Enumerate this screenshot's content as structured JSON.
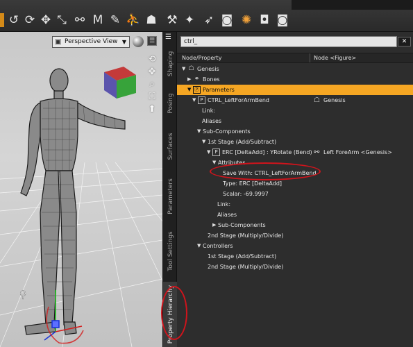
{
  "toolbar": {
    "icons": [
      "pointer-swirl-icon",
      "rotate-icon",
      "move-icon",
      "scale-icon",
      "joint-icon",
      "node-icon",
      "paint-icon",
      "figure-icon",
      "figure-select-icon",
      "morph-icon",
      "bone-icon",
      "pointer-icon",
      "render-icon",
      "light-icon",
      "camera-icon",
      "settings-camera-icon"
    ]
  },
  "viewport": {
    "view_label": "Perspective View",
    "nav_icons": [
      "rotate-orbit-icon",
      "pan-icon",
      "zoom-icon",
      "frame-icon",
      "home-icon"
    ]
  },
  "side_tabs": [
    {
      "label": "Shaping"
    },
    {
      "label": "Posing"
    },
    {
      "label": "Surfaces"
    },
    {
      "label": "Parameters"
    },
    {
      "label": "Tool Settings"
    },
    {
      "label": "Property Hierarchy"
    }
  ],
  "panel": {
    "search_value": "ctrl_",
    "clear_label": "✕",
    "col_node_property": "Node/Property",
    "col_node": "Node <Figure>"
  },
  "tree": [
    {
      "label": "Genesis",
      "twisty": "▼",
      "icon": "figure-icon"
    },
    {
      "label": "Bones",
      "twisty": "▶",
      "icon": "bones-icon"
    },
    {
      "label": "Parameters",
      "twisty": "▼",
      "icon": "parameters-icon",
      "highlighted": true
    },
    {
      "label": "CTRL_LeftForArmBend",
      "twisty": "▼",
      "icon": "property-icon",
      "value": "Genesis",
      "value_icon": "figure-icon"
    },
    {
      "label": "Link:"
    },
    {
      "label": "Aliases"
    },
    {
      "label": "Sub-Components",
      "twisty": "▼"
    },
    {
      "label": "1st Stage (Add/Subtract)",
      "twisty": "▼"
    },
    {
      "label": "ERC [DeltaAdd] : YRotate (Bend)",
      "twisty": "▼",
      "icon": "property-icon",
      "value": "Left ForeArm <Genesis>",
      "value_icon": "bone-icon"
    },
    {
      "label": "Attributes",
      "twisty": "▼"
    },
    {
      "label": "Save With: CTRL_LeftForArmBend"
    },
    {
      "label": "Type: ERC [DeltaAdd]"
    },
    {
      "label": "Scalar: -69.9997"
    },
    {
      "label": "Link:"
    },
    {
      "label": "Aliases"
    },
    {
      "label": "Sub-Components",
      "twisty": "▶"
    },
    {
      "label": "2nd Stage (Multiply/Divide)"
    },
    {
      "label": "Controllers",
      "twisty": "▼"
    },
    {
      "label": "1st Stage (Add/Subtract)"
    },
    {
      "label": "2nd Stage (Multiply/Divide)"
    }
  ],
  "colors": {
    "highlight": "#f5a623",
    "annotation": "#d0141c"
  }
}
